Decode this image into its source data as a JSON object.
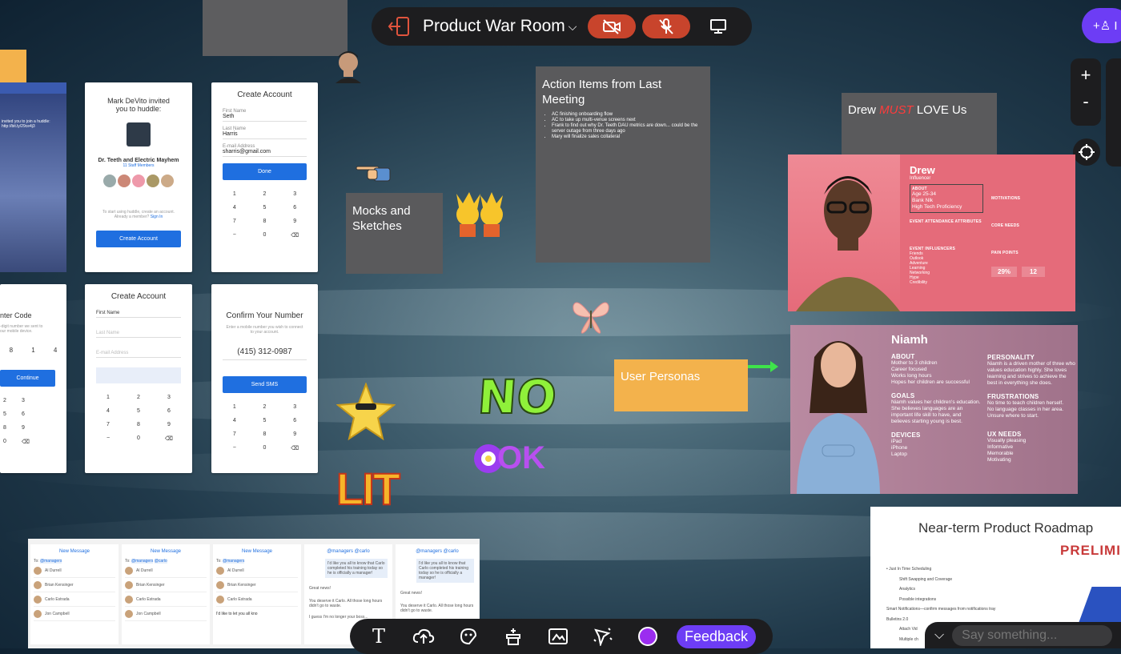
{
  "room": {
    "title": "Product War Room"
  },
  "mocks": {
    "invite": {
      "line1": "Mark DeVito invited",
      "line2": "you to huddle:",
      "group": "Dr. Teeth and Electric Mayhem",
      "members": "11 Staff Members",
      "hint": "To start using huddle, create an account.",
      "already": "Already a member?",
      "signin": "Sign In",
      "button": "Create Account"
    },
    "create1": {
      "title": "Create Account",
      "f1l": "First Name",
      "f1v": "Seth",
      "f2l": "Last Name",
      "f2v": "Harris",
      "f3l": "E-mail Address",
      "f3v": "sharris@gmail.com",
      "button": "Done"
    },
    "enter_code": {
      "title": "nter Code",
      "sub1": "-digit number we sent to",
      "sub2": "our mobile device.",
      "code": [
        "8",
        "1",
        "4"
      ],
      "button": "Continue"
    },
    "create2": {
      "title": "Create Account",
      "f1l": "First Name",
      "f2l": "Last Name",
      "f3l": "E-mail Address"
    },
    "confirm": {
      "title": "Confirm Your Number",
      "sub": "Enter a mobile number you wish to connect to your account.",
      "number": "(415) 312-0987",
      "button": "Send SMS"
    },
    "keypad": [
      "1",
      "2",
      "3",
      "4",
      "5",
      "6",
      "7",
      "8",
      "9",
      "−",
      "0",
      "⌫"
    ],
    "notif": "invited you to join a huddle: http://bit.ly/29ce4j3"
  },
  "notes": {
    "mocks": "Mocks and Sketches",
    "action_title": "Action Items from Last Meeting",
    "action_items": [
      "AC finishing onboarding flow",
      "AC to take up multi-venue screens next",
      "Frank to find out why Dr. Teeth DAU metrics are down... could be the server outage from three days ago",
      "Mary will finalize sales collateral"
    ],
    "drew_pre": "Drew ",
    "drew_must": "MUST",
    "drew_post": " LOVE Us",
    "personas": "User Personas"
  },
  "drew": {
    "name": "Drew",
    "role": "Influencer",
    "about": "ABOUT",
    "about_items": [
      "Age 25-34",
      "Bank Nlk",
      "High Tech Proficiency"
    ],
    "motivations": "MOTIVATIONS",
    "attrs": "EVENT ATTENDANCE ATTRIBUTES",
    "core": "CORE NEEDS",
    "influencers": "EVENT INFLUENCERS",
    "infl_items": [
      "Friends",
      "Outlook",
      "Adventure",
      "Learning",
      "Networking",
      "Hype",
      "Credibility"
    ],
    "pain": "PAIN POINTS",
    "stat1": "29%",
    "stat2": "12"
  },
  "niamh": {
    "name": "Niamh",
    "about": "ABOUT",
    "about_items": [
      "Mother to 3 children",
      "Career focused",
      "Works long hours",
      "Hopes her children are successful"
    ],
    "personality": "PERSONALITY",
    "personality_text": "Niamh is a driven mother of three who values education highly. She loves learning and strives to achieve the best in everything she does.",
    "goals": "GOALS",
    "goals_text": "Niamh values her children's education. She believes languages are an important life skill to have, and believes starting young is best.",
    "frustrations": "FRUSTRATIONS",
    "frustrations_items": [
      "No time to teach children herself.",
      "No language classes in her area.",
      "Unsure where to start."
    ],
    "devices": "DEVICES",
    "devices_items": [
      "iPad",
      "iPhone",
      "Laptop"
    ],
    "ux": "UX NEEDS",
    "ux_items": [
      "Visually pleasing",
      "Informative",
      "Memorable",
      "Motivating"
    ]
  },
  "roadmap": {
    "title": "Near-term Product Roadmap",
    "stamp": "PRELIMIN",
    "items": [
      "Just In Time Scheduling",
      "Shift Swapping and Coverage",
      "Analytics",
      "Possible integrations",
      "Smart Notifications—confirm messages from notifications tray",
      "Bulletins 2.0",
      "Attach Vid",
      "Multiple ch"
    ]
  },
  "stickers": {
    "no": "NO",
    "ok": "OK",
    "lit": "LIT"
  },
  "messages": {
    "new_message": "New Message",
    "to": "To:",
    "tag": "@managers",
    "tag2": "@carlo",
    "names": [
      "Al Durrell",
      "Brian Kensinger",
      "Carlo Estrada",
      "Jon Campbell"
    ],
    "bubble": "I'd like you all to know that Carlo completed his training today so he is officially a manager!",
    "reply": "Great news!",
    "reply2": "You deserve it Carlo. All those long hours didn't go to waste.",
    "reply3": "I guess I'm no longer your boss...",
    "input": "I'd like to let you all kno"
  },
  "toolbar": {
    "feedback": "Feedback"
  },
  "chat": {
    "placeholder": "Say something..."
  },
  "colors": {
    "accent": "#6d3df5",
    "red": "#c8442c",
    "note_orange": "#f3b24c"
  }
}
